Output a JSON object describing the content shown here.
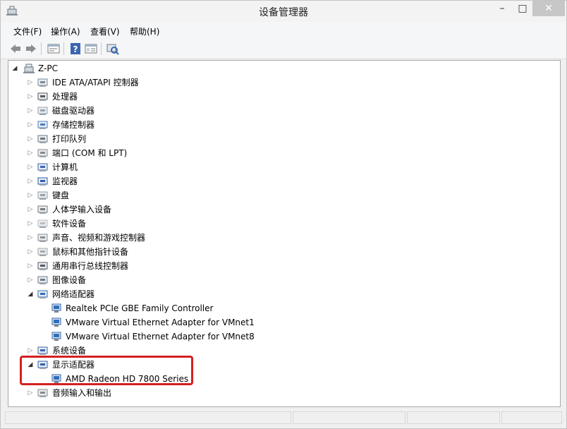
{
  "window": {
    "title": "设备管理器"
  },
  "menu": [
    "文件(F)",
    "操作(A)",
    "查看(V)",
    "帮助(H)"
  ],
  "toolbar": {
    "icons": [
      "back-icon",
      "forward-icon",
      "properties-view-icon",
      "help-icon",
      "details-view-icon",
      "scan-hardware-icon"
    ]
  },
  "tree": {
    "root": "Z-PC",
    "categories": [
      {
        "label": "IDE ATA/ATAPI 控制器",
        "expanded": false
      },
      {
        "label": "处理器",
        "expanded": false
      },
      {
        "label": "磁盘驱动器",
        "expanded": false
      },
      {
        "label": "存储控制器",
        "expanded": false
      },
      {
        "label": "打印队列",
        "expanded": false
      },
      {
        "label": "端口 (COM 和 LPT)",
        "expanded": false
      },
      {
        "label": "计算机",
        "expanded": false
      },
      {
        "label": "监视器",
        "expanded": false
      },
      {
        "label": "键盘",
        "expanded": false
      },
      {
        "label": "人体学输入设备",
        "expanded": false
      },
      {
        "label": "软件设备",
        "expanded": false
      },
      {
        "label": "声音、视频和游戏控制器",
        "expanded": false
      },
      {
        "label": "鼠标和其他指针设备",
        "expanded": false
      },
      {
        "label": "通用串行总线控制器",
        "expanded": false
      },
      {
        "label": "图像设备",
        "expanded": false
      },
      {
        "label": "网络适配器",
        "expanded": true,
        "children": [
          "Realtek PCIe GBE Family Controller",
          "VMware Virtual Ethernet Adapter for VMnet1",
          "VMware Virtual Ethernet Adapter for VMnet8"
        ]
      },
      {
        "label": "系统设备",
        "expanded": false
      },
      {
        "label": "显示适配器",
        "expanded": true,
        "children": [
          "AMD Radeon HD 7800 Series"
        ]
      },
      {
        "label": "音频输入和输出",
        "expanded": false
      }
    ]
  },
  "colors": {
    "highlight": "#d42020",
    "close_button": "#c7c7c7"
  }
}
